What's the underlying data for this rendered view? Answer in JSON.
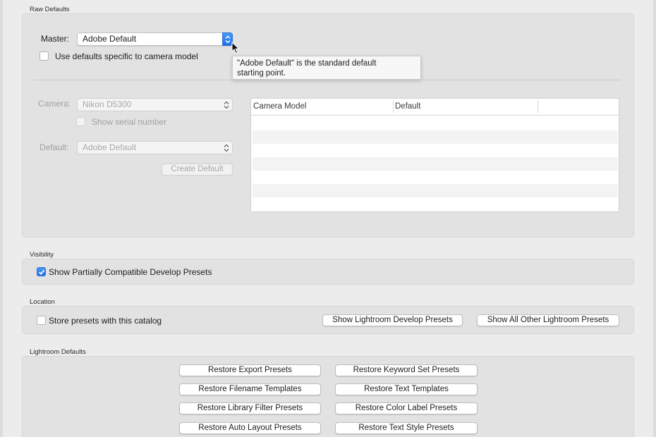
{
  "raw_defaults": {
    "title": "Raw Defaults",
    "master_label": "Master:",
    "master_value": "Adobe Default",
    "camera_specific_label": "Use defaults specific to camera model",
    "camera_label": "Camera:",
    "camera_value": "Nikon D5300",
    "show_serial_label": "Show serial number",
    "default_label": "Default:",
    "default_value": "Adobe Default",
    "create_default_label": "Create Default",
    "tooltip_line1": "\"Adobe Default\" is the standard default",
    "tooltip_line2": "starting point.",
    "table_headers": [
      "Camera Model",
      "Default"
    ]
  },
  "visibility": {
    "title": "Visibility",
    "show_partial_label": "Show Partially Compatible Develop Presets",
    "show_partial_checked": true
  },
  "location": {
    "title": "Location",
    "store_presets_label": "Store presets with this catalog",
    "show_develop_label": "Show Lightroom Develop Presets",
    "show_other_label": "Show All Other Lightroom Presets"
  },
  "lightroom_defaults": {
    "title": "Lightroom Defaults",
    "buttons_left": [
      "Restore Export Presets",
      "Restore Filename Templates",
      "Restore Library Filter Presets",
      "Restore Auto Layout Presets"
    ],
    "buttons_right": [
      "Restore Keyword Set Presets",
      "Restore Text Templates",
      "Restore Color Label Presets",
      "Restore Text Style Presets"
    ]
  },
  "colors": {
    "accent": "#1d6fe8",
    "panel": "#e2e2e2",
    "background": "#ececec"
  }
}
